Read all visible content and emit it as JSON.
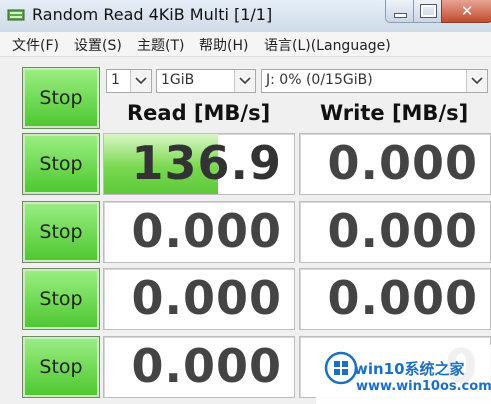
{
  "window": {
    "title": "Random Read 4KiB Multi [1/1]"
  },
  "menu": {
    "items": [
      "文件(F)",
      "设置(S)",
      "主题(T)",
      "帮助(H)",
      "语言(L)(Language)"
    ]
  },
  "controls": {
    "count": "1",
    "size": "1GiB",
    "drive": "J: 0% (0/15GiB)"
  },
  "headers": {
    "read": "Read [MB/s]",
    "write": "Write [MB/s]"
  },
  "rows": [
    {
      "button": "Stop",
      "read": "136.9",
      "write": "0.000",
      "read_progress": 0.6
    },
    {
      "button": "Stop",
      "read": "0.000",
      "write": "0.000"
    },
    {
      "button": "Stop",
      "read": "0.000",
      "write": "0.000"
    },
    {
      "button": "Stop",
      "read": "0.000",
      "write": "0.000"
    },
    {
      "button": "Stop",
      "read": "0.000",
      "write": "0"
    }
  ],
  "watermark": {
    "title": "win10系统之家",
    "url": "www.win10os.com"
  },
  "colors": {
    "stop_button": "#5fd23f",
    "progress": "#7ad850",
    "watermark": "#1e6fc2"
  },
  "icons": {
    "app": "disk-drive-icon",
    "dropdown": "chevron-down-icon"
  }
}
